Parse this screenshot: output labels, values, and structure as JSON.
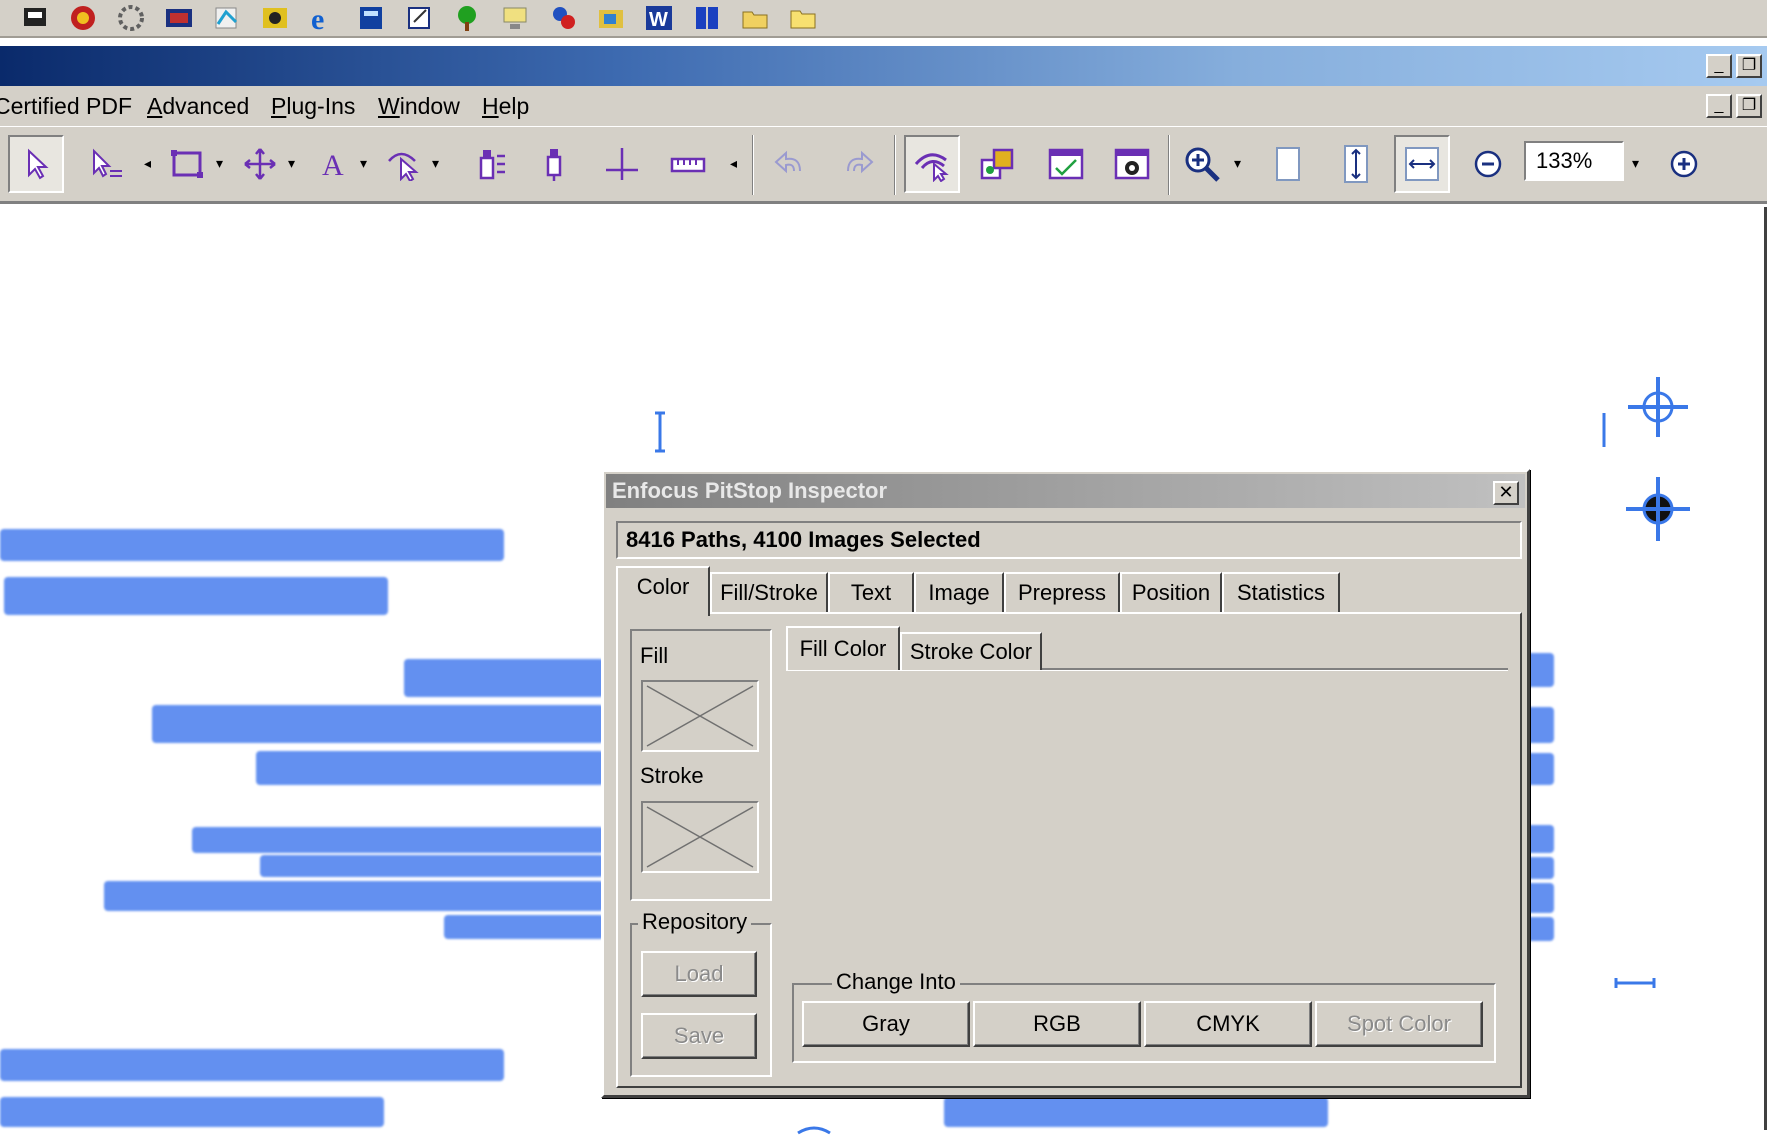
{
  "menu": {
    "items": [
      {
        "label": "Certified PDF",
        "mnemonic": ""
      },
      {
        "label": "Advanced",
        "mnemonic": "A"
      },
      {
        "label": "Plug-Ins",
        "mnemonic": "P"
      },
      {
        "label": "Window",
        "mnemonic": "W"
      },
      {
        "label": "Help",
        "mnemonic": "H"
      }
    ]
  },
  "toolbar": {
    "zoom_value": "133%"
  },
  "inspector": {
    "title": "Enfocus PitStop Inspector",
    "close_glyph": "✕",
    "selection_info": "8416 Paths, 4100 Images Selected",
    "tabs": [
      "Color",
      "Fill/Stroke",
      "Text",
      "Image",
      "Prepress",
      "Position",
      "Statistics"
    ],
    "active_tab": "Color",
    "fill_label": "Fill",
    "stroke_label": "Stroke",
    "repository_label": "Repository",
    "load_label": "Load",
    "save_label": "Save",
    "subtabs": [
      "Fill Color",
      "Stroke Color"
    ],
    "active_subtab": "Fill Color",
    "change_into_label": "Change Into",
    "change_buttons": [
      {
        "label": "Gray",
        "enabled": true
      },
      {
        "label": "RGB",
        "enabled": true
      },
      {
        "label": "CMYK",
        "enabled": true
      },
      {
        "label": "Spot Color",
        "enabled": false
      }
    ]
  },
  "colors": {
    "selection_highlight": "#5b8bf0",
    "icon_purple": "#6a2fb4",
    "dialog_face": "#d4d0c8"
  }
}
